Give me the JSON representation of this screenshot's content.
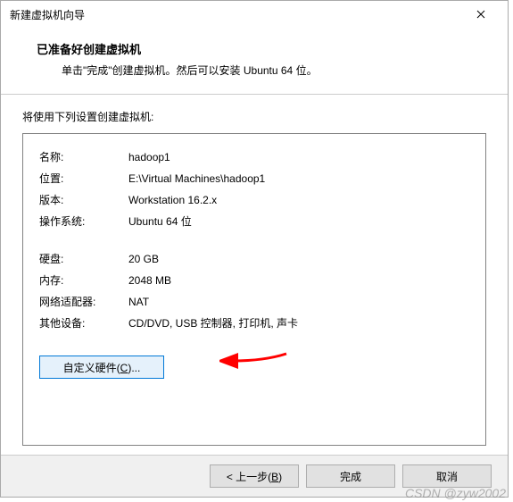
{
  "window": {
    "title": "新建虚拟机向导"
  },
  "header": {
    "title": "已准备好创建虚拟机",
    "subtitle": "单击\"完成\"创建虚拟机。然后可以安装 Ubuntu 64 位。"
  },
  "body": {
    "settings_label": "将使用下列设置创建虚拟机:",
    "rows": [
      {
        "key": "名称:",
        "value": "hadoop1"
      },
      {
        "key": "位置:",
        "value": "E:\\Virtual Machines\\hadoop1"
      },
      {
        "key": "版本:",
        "value": "Workstation 16.2.x"
      },
      {
        "key": "操作系统:",
        "value": "Ubuntu 64 位"
      }
    ],
    "rows2": [
      {
        "key": "硬盘:",
        "value": "20 GB"
      },
      {
        "key": "内存:",
        "value": "2048 MB"
      },
      {
        "key": "网络适配器:",
        "value": "NAT"
      },
      {
        "key": "其他设备:",
        "value": "CD/DVD, USB 控制器, 打印机, 声卡"
      }
    ],
    "custom_hw_prefix": "自定义硬件(",
    "custom_hw_key": "C",
    "custom_hw_suffix": ")..."
  },
  "footer": {
    "back_prefix": "< 上一步(",
    "back_key": "B",
    "back_suffix": ")",
    "finish": "完成",
    "cancel": "取消"
  },
  "watermark": "CSDN @zyw2002"
}
